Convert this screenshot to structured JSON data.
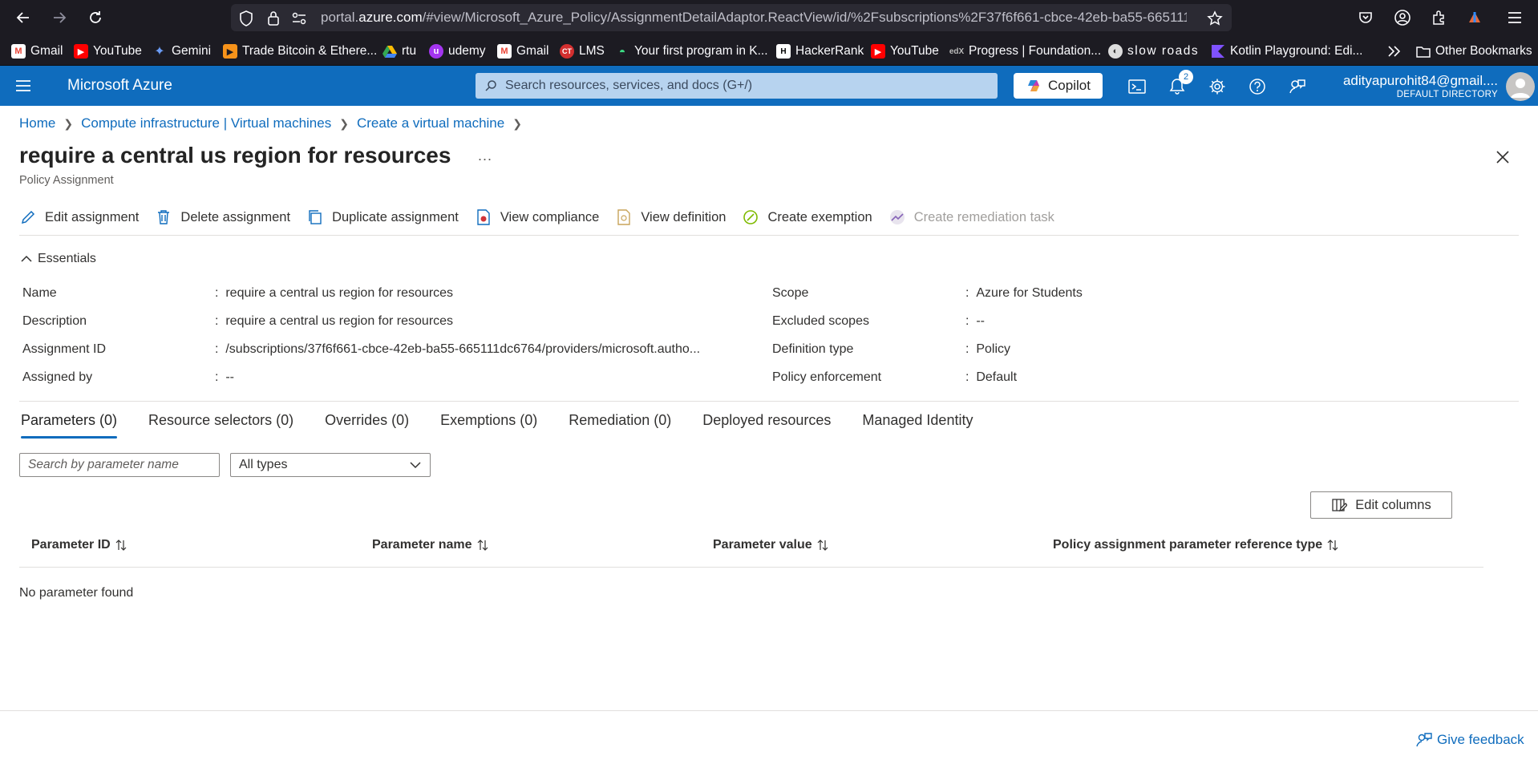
{
  "browser": {
    "url_prefix": "portal.",
    "url_domain": "azure.com",
    "url_path": "/#view/Microsoft_Azure_Policy/AssignmentDetailAdaptor.ReactView/id/%2Fsubscriptions%2F37f6f661-cbce-42eb-ba55-665111",
    "bookmarks": [
      {
        "label": "Gmail",
        "icon": "gmail-icon",
        "color": "#ea4335"
      },
      {
        "label": "YouTube",
        "icon": "youtube-icon",
        "color": "#ff0000"
      },
      {
        "label": "Gemini",
        "icon": "gemini-icon",
        "color": "#4e8af4"
      },
      {
        "label": "Trade Bitcoin & Ethere...",
        "icon": "trade-icon",
        "color": "#f7931a"
      },
      {
        "label": "rtu",
        "icon": "drive-icon",
        "color": "#34a853"
      },
      {
        "label": "udemy",
        "icon": "udemy-icon",
        "color": "#a435f0"
      },
      {
        "label": "Gmail",
        "icon": "gmail-icon",
        "color": "#ea4335"
      },
      {
        "label": "LMS",
        "icon": "lms-icon",
        "color": "#d32f2f"
      },
      {
        "label": "Your first program in K...",
        "icon": "android-icon",
        "color": "#3ddc84"
      },
      {
        "label": "HackerRank",
        "icon": "hackerrank-icon",
        "color": "#1ba94c"
      },
      {
        "label": "YouTube",
        "icon": "youtube-icon",
        "color": "#ff0000"
      },
      {
        "label": "Progress | Foundation...",
        "icon": "edx-icon",
        "color": "#02262b"
      },
      {
        "label": "slow roads",
        "icon": "slowroads-icon",
        "color": "#dddddd"
      },
      {
        "label": "Kotlin Playground: Edi...",
        "icon": "kotlin-icon",
        "color": "#7f52ff"
      }
    ],
    "other_bookmarks": "Other Bookmarks"
  },
  "header": {
    "brand": "Microsoft Azure",
    "search_placeholder": "Search resources, services, and docs (G+/)",
    "copilot_label": "Copilot",
    "notification_count": "2",
    "account_email": "adityapurohit84@gmail....",
    "account_directory": "DEFAULT DIRECTORY"
  },
  "breadcrumb": [
    "Home",
    "Compute infrastructure | Virtual machines",
    "Create a virtual machine"
  ],
  "page": {
    "title": "require a central us region for resources",
    "subtitle": "Policy Assignment",
    "more": "..."
  },
  "toolbar": [
    {
      "label": "Edit assignment",
      "icon": "edit-icon",
      "disabled": false
    },
    {
      "label": "Delete assignment",
      "icon": "delete-icon",
      "disabled": false
    },
    {
      "label": "Duplicate assignment",
      "icon": "duplicate-icon",
      "disabled": false
    },
    {
      "label": "View compliance",
      "icon": "compliance-icon",
      "disabled": false
    },
    {
      "label": "View definition",
      "icon": "definition-icon",
      "disabled": false
    },
    {
      "label": "Create exemption",
      "icon": "exemption-icon",
      "disabled": false
    },
    {
      "label": "Create remediation task",
      "icon": "remediation-icon",
      "disabled": true
    }
  ],
  "essentials": {
    "toggle_label": "Essentials",
    "left": [
      {
        "label": "Name",
        "value": "require a central us region for resources"
      },
      {
        "label": "Description",
        "value": "require a central us region for resources"
      },
      {
        "label": "Assignment ID",
        "value": "/subscriptions/37f6f661-cbce-42eb-ba55-665111dc6764/providers/microsoft.autho..."
      },
      {
        "label": "Assigned by",
        "value": "--"
      }
    ],
    "right": [
      {
        "label": "Scope",
        "value": "Azure for Students"
      },
      {
        "label": "Excluded scopes",
        "value": "--"
      },
      {
        "label": "Definition type",
        "value": "Policy"
      },
      {
        "label": "Policy enforcement",
        "value": "Default"
      }
    ],
    "separator": ":"
  },
  "tabs": [
    {
      "label": "Parameters (0)",
      "active": true
    },
    {
      "label": "Resource selectors (0)",
      "active": false
    },
    {
      "label": "Overrides (0)",
      "active": false
    },
    {
      "label": "Exemptions (0)",
      "active": false
    },
    {
      "label": "Remediation (0)",
      "active": false
    },
    {
      "label": "Deployed resources",
      "active": false
    },
    {
      "label": "Managed Identity",
      "active": false
    }
  ],
  "params": {
    "search_placeholder": "Search by parameter name",
    "type_filter": "All types",
    "edit_columns": "Edit columns",
    "columns": [
      "Parameter ID",
      "Parameter name",
      "Parameter value",
      "Policy assignment parameter reference type"
    ],
    "empty_message": "No parameter found"
  },
  "footer": {
    "feedback": "Give feedback"
  },
  "colors": {
    "azure_blue": "#0f6cbd",
    "browser_bg": "#1c1b22"
  }
}
